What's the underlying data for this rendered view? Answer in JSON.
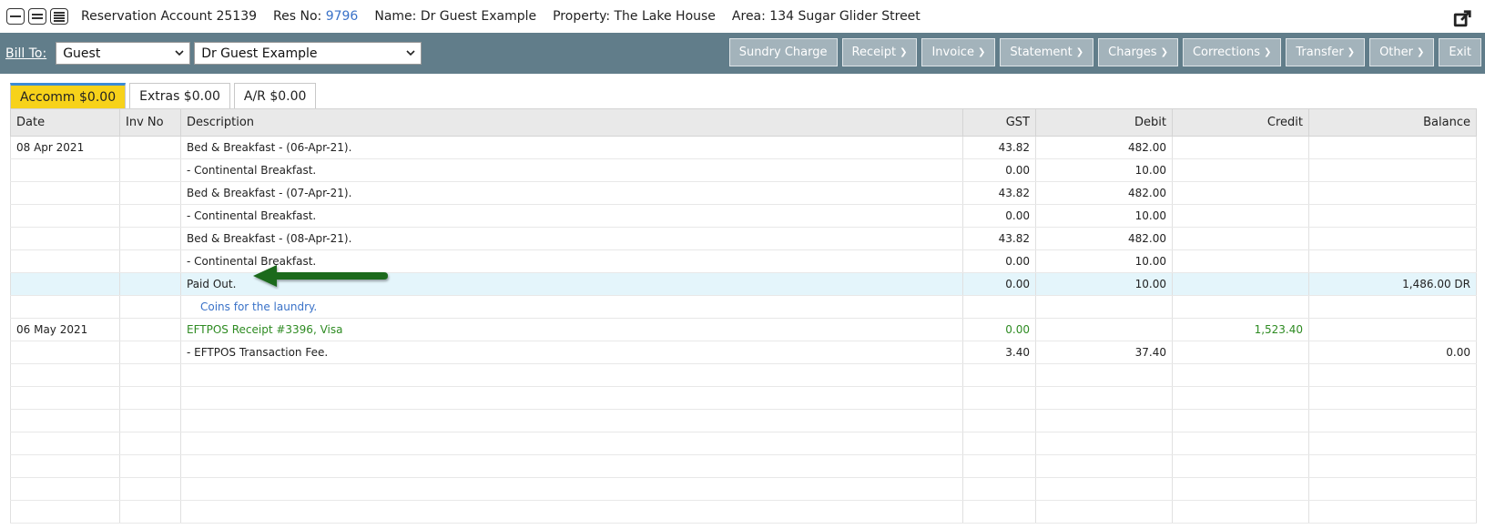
{
  "header": {
    "account_label": "Reservation Account 25139",
    "res_no_label": "Res No:",
    "res_no_value": "9796",
    "name_label": "Name: Dr Guest Example",
    "property_label": "Property: The Lake House",
    "area_label": "Area: 134 Sugar Glider Street"
  },
  "toolbar": {
    "bill_to_label": "Bill To:",
    "bill_to_type": "Guest",
    "bill_to_name": "Dr Guest Example",
    "buttons": {
      "sundry": "Sundry Charge",
      "receipt": "Receipt",
      "invoice": "Invoice",
      "statement": "Statement",
      "charges": "Charges",
      "corrections": "Corrections",
      "transfer": "Transfer",
      "other": "Other",
      "exit": "Exit"
    }
  },
  "tabs": {
    "accomm": "Accomm $0.00",
    "extras": "Extras $0.00",
    "ar": "A/R $0.00"
  },
  "table": {
    "headers": {
      "date": "Date",
      "inv_no": "Inv No",
      "description": "Description",
      "gst": "GST",
      "debit": "Debit",
      "credit": "Credit",
      "balance": "Balance"
    },
    "rows": [
      {
        "date": "08 Apr 2021",
        "inv": "",
        "desc": "Bed & Breakfast - (06-Apr-21).",
        "gst": "43.82",
        "debit": "482.00",
        "credit": "",
        "balance": ""
      },
      {
        "date": "",
        "inv": "",
        "desc": " - Continental Breakfast.",
        "gst": "0.00",
        "debit": "10.00",
        "credit": "",
        "balance": ""
      },
      {
        "date": "",
        "inv": "",
        "desc": "Bed & Breakfast - (07-Apr-21).",
        "gst": "43.82",
        "debit": "482.00",
        "credit": "",
        "balance": ""
      },
      {
        "date": "",
        "inv": "",
        "desc": " - Continental Breakfast.",
        "gst": "0.00",
        "debit": "10.00",
        "credit": "",
        "balance": ""
      },
      {
        "date": "",
        "inv": "",
        "desc": "Bed & Breakfast - (08-Apr-21).",
        "gst": "43.82",
        "debit": "482.00",
        "credit": "",
        "balance": ""
      },
      {
        "date": "",
        "inv": "",
        "desc": " - Continental Breakfast.",
        "gst": "0.00",
        "debit": "10.00",
        "credit": "",
        "balance": ""
      },
      {
        "date": "",
        "inv": "",
        "desc": "Paid Out.",
        "gst": "0.00",
        "debit": "10.00",
        "credit": "",
        "balance": "1,486.00 DR"
      },
      {
        "date": "",
        "inv": "",
        "desc": "Coins for the laundry.",
        "gst": "",
        "debit": "",
        "credit": "",
        "balance": ""
      },
      {
        "date": "06 May 2021",
        "inv": "",
        "desc": "EFTPOS Receipt #3396, Visa",
        "gst": "0.00",
        "debit": "",
        "credit": "1,523.40",
        "balance": ""
      },
      {
        "date": "",
        "inv": "",
        "desc": " - EFTPOS Transaction Fee.",
        "gst": "3.40",
        "debit": "37.40",
        "credit": "",
        "balance": "0.00"
      }
    ]
  },
  "icons": {
    "view_compact": "view-compact-icon",
    "view_normal": "view-normal-icon",
    "view_expanded": "view-expanded-icon",
    "popout": "external-link-icon",
    "annotation_arrow": "arrow-icon"
  },
  "colors": {
    "toolbar": "#617d8a",
    "active_tab": "#f7d21a",
    "highlight_row": "#e4f5fb",
    "receipt_green": "#2e8b22",
    "note_blue": "#3a72c8",
    "arrow_green": "#1e6a1e"
  }
}
